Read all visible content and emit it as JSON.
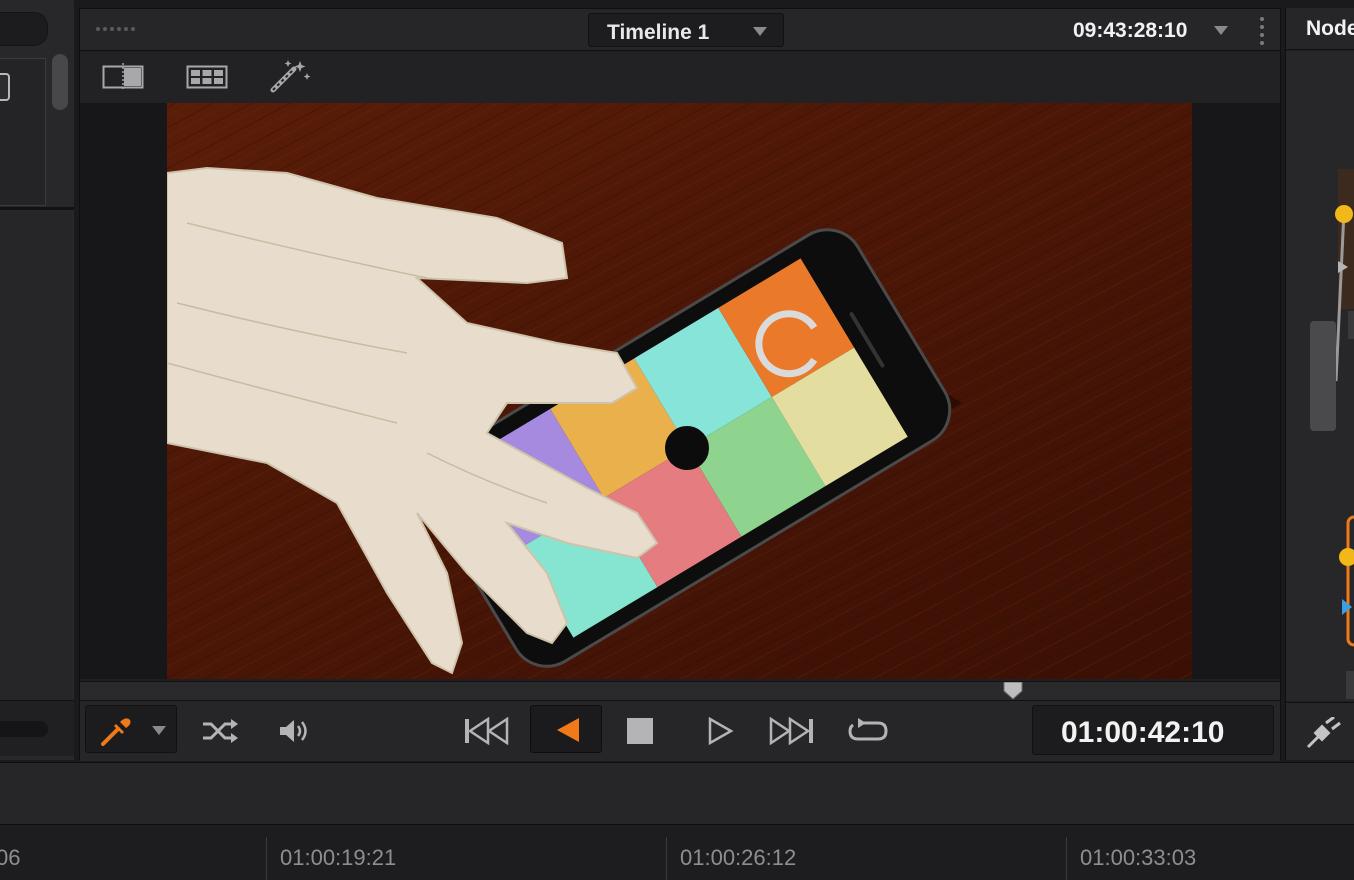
{
  "viewer": {
    "timeline_name": "Timeline 1",
    "source_timecode": "09:43:28:10",
    "record_timecode": "01:00:42:10"
  },
  "toolbar": {
    "icons": [
      "split-view-icon",
      "grid-icon",
      "magic-wand-icon"
    ]
  },
  "transport": {
    "icons": [
      "eyedropper-icon",
      "shuffle-icon",
      "volume-icon",
      "skip-back-icon",
      "play-reverse-icon",
      "stop-icon",
      "play-icon",
      "skip-forward-icon",
      "loop-icon"
    ],
    "active": "play-reverse",
    "accent_color": "#f07a1a"
  },
  "right_panel": {
    "title": "Node"
  },
  "ruler": {
    "labels": [
      "06",
      "01:00:19:21",
      "01:00:26:12",
      "01:00:33:03"
    ]
  }
}
